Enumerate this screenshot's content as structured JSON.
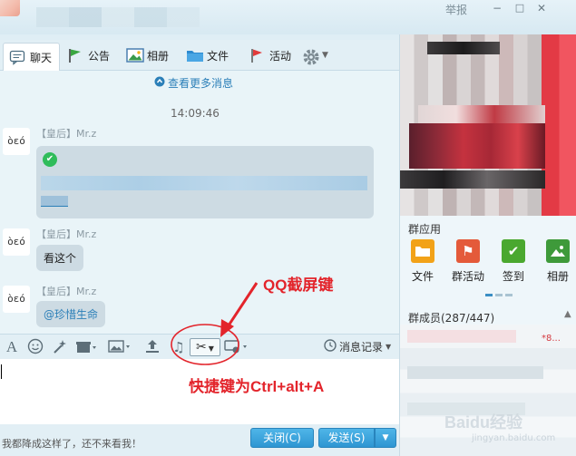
{
  "window": {
    "report": "举报",
    "minimize": "−",
    "maximize": "□",
    "close": "✕"
  },
  "tabs": [
    {
      "label": "聊天",
      "icon": "chat-icon"
    },
    {
      "label": "公告",
      "icon": "flag-icon"
    },
    {
      "label": "相册",
      "icon": "photo-icon"
    },
    {
      "label": "文件",
      "icon": "folder-icon"
    },
    {
      "label": "活动",
      "icon": "red-flag-icon"
    }
  ],
  "chat": {
    "more_messages": "查看更多消息",
    "time": "14:09:46",
    "messages": [
      {
        "avatar": "òεó",
        "sender": "【皇后】Mr.z",
        "type": "card"
      },
      {
        "avatar": "òεó",
        "sender": "【皇后】Mr.z",
        "text": "看这个"
      },
      {
        "avatar": "òεó",
        "sender": "【皇后】Mr.z",
        "text": "@珍惜生命"
      }
    ]
  },
  "toolbar": {
    "history": "消息记录"
  },
  "bottom": {
    "ad_text": "我都降成这样了，还不来看我！",
    "close_label": "关闭(C)",
    "send_label": "发送(S)"
  },
  "annotations": {
    "screenshot_key": "QQ截屏键",
    "shortcut": "快捷键为Ctrl+alt+A"
  },
  "right_panel": {
    "group_apps_title": "群应用",
    "apps": [
      {
        "label": "文件",
        "color": "#f2a218"
      },
      {
        "label": "群活动",
        "color": "#e45a3a"
      },
      {
        "label": "签到",
        "color": "#4aa82f"
      },
      {
        "label": "相册",
        "color": "#3e9a3a"
      }
    ],
    "members_title": "群成员(287/447)",
    "member_red_text": "*8..."
  },
  "watermark": {
    "brand": "Baidu经验",
    "sub": "jingyan.baidu.com"
  }
}
